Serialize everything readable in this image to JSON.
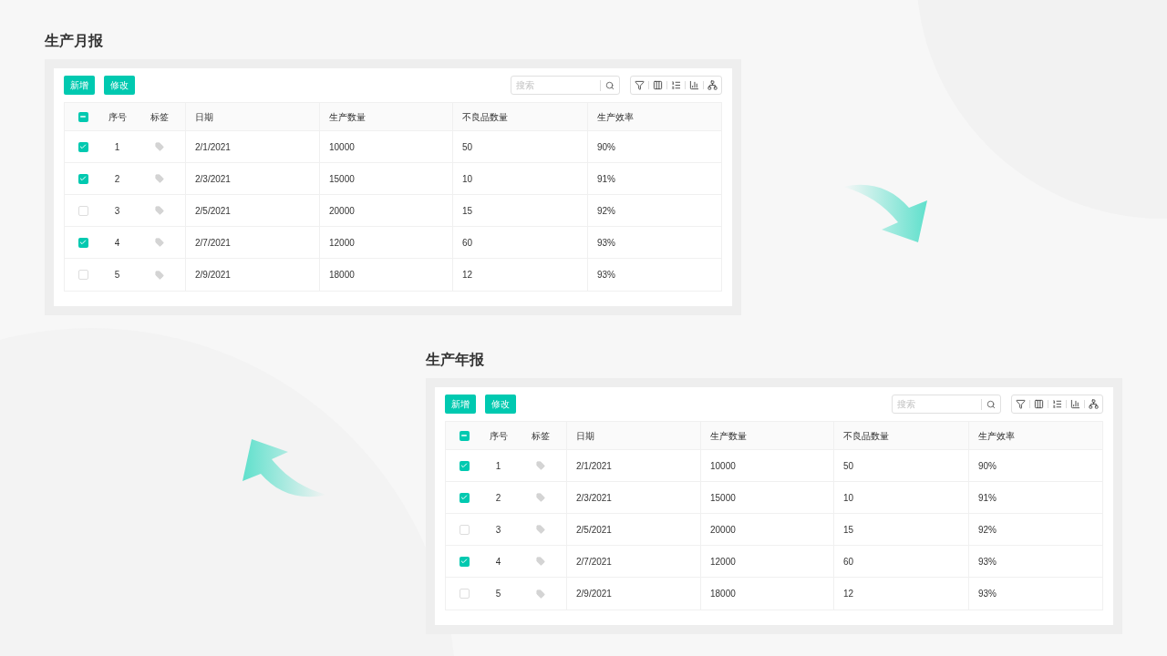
{
  "reports": [
    {
      "title": "生产月报",
      "buttons": [
        "新增",
        "修改"
      ],
      "search": {
        "placeholder": "搜索"
      },
      "select_all_partial": true,
      "columns": [
        "序号",
        "标签",
        "日期",
        "生产数量",
        "不良品数量",
        "生产效率"
      ],
      "rows": [
        {
          "checked": true,
          "cells": [
            "1",
            "",
            "2/1/2021",
            "10000",
            "50",
            "90%"
          ]
        },
        {
          "checked": true,
          "cells": [
            "2",
            "",
            "2/3/2021",
            "15000",
            "10",
            "91%"
          ]
        },
        {
          "checked": false,
          "cells": [
            "3",
            "",
            "2/5/2021",
            "20000",
            "15",
            "92%"
          ]
        },
        {
          "checked": true,
          "cells": [
            "4",
            "",
            "2/7/2021",
            "12000",
            "60",
            "93%"
          ]
        },
        {
          "checked": false,
          "cells": [
            "5",
            "",
            "2/9/2021",
            "18000",
            "12",
            "93%"
          ]
        }
      ]
    },
    {
      "title": "生产年报",
      "buttons": [
        "新增",
        "修改"
      ],
      "search": {
        "placeholder": "搜索"
      },
      "select_all_partial": true,
      "columns": [
        "序号",
        "标签",
        "日期",
        "生产数量",
        "不良品数量",
        "生产效率"
      ],
      "rows": [
        {
          "checked": true,
          "cells": [
            "1",
            "",
            "2/1/2021",
            "10000",
            "50",
            "90%"
          ]
        },
        {
          "checked": true,
          "cells": [
            "2",
            "",
            "2/3/2021",
            "15000",
            "10",
            "91%"
          ]
        },
        {
          "checked": false,
          "cells": [
            "3",
            "",
            "2/5/2021",
            "20000",
            "15",
            "92%"
          ]
        },
        {
          "checked": true,
          "cells": [
            "4",
            "",
            "2/7/2021",
            "12000",
            "60",
            "93%"
          ]
        },
        {
          "checked": false,
          "cells": [
            "5",
            "",
            "2/9/2021",
            "18000",
            "12",
            "93%"
          ]
        }
      ]
    }
  ]
}
